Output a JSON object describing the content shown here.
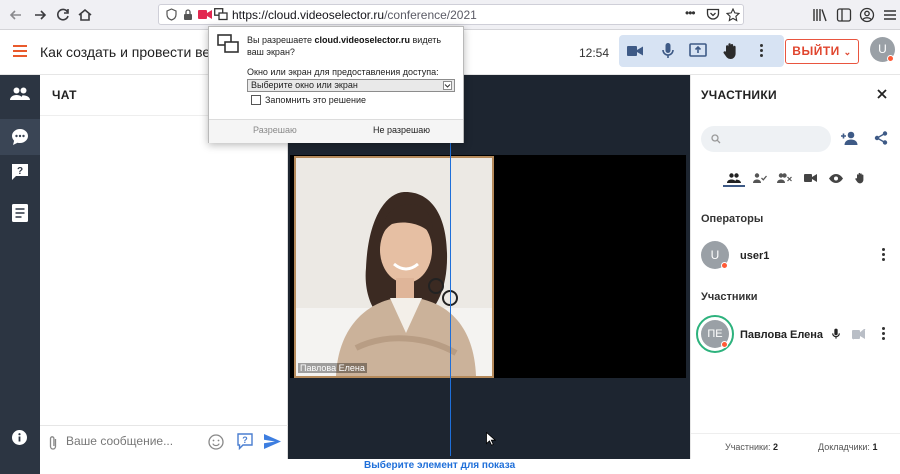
{
  "browser": {
    "url_host": "https://cloud.videoselector.ru",
    "url_path": "/conference/2021",
    "more_label": "•••"
  },
  "header": {
    "title": "Как создать и провести вебинар",
    "time": "12:54",
    "exit_label": "ВЫЙТИ",
    "user_initial": "U"
  },
  "chat": {
    "title": "ЧАТ",
    "placeholder": "Ваше сообщение..."
  },
  "video": {
    "participant_name": "Павлова Елена"
  },
  "participants": {
    "title": "УЧАСТНИКИ",
    "operators_title": "Операторы",
    "participants_title": "Участники",
    "operators": [
      {
        "initial": "U",
        "name": "user1"
      }
    ],
    "members": [
      {
        "initial": "ПЕ",
        "name": "Павлова Елена"
      }
    ],
    "participants_count_label": "Участники:",
    "participants_count": "2",
    "speakers_count_label": "Докладчики:",
    "speakers_count": "1"
  },
  "dialog": {
    "question_prefix": "Вы разрешаете ",
    "question_host": "cloud.videoselector.ru",
    "question_suffix": " видеть ваш экран?",
    "select_label": "Окно или экран для предоставления доступа:",
    "select_value": "Выберите окно или экран",
    "remember_label": "Запомнить это решение",
    "allow_label": "Разрешаю",
    "deny_label": "Не разрешаю"
  },
  "annotation": {
    "caption": "Выберите элемент для показа"
  },
  "colors": {
    "accent": "#1e6fd9",
    "exit": "#e0452e",
    "rail": "#2c3542",
    "video_bg": "#1d2530"
  }
}
